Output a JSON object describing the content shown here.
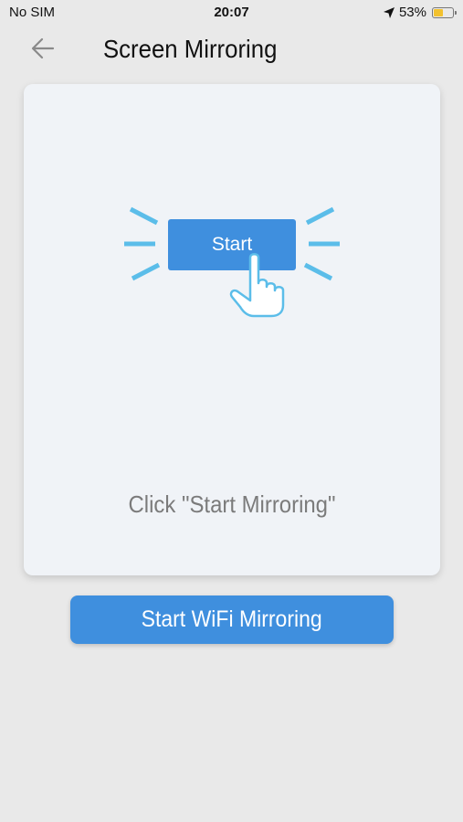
{
  "status_bar": {
    "carrier": "No SIM",
    "time": "20:07",
    "battery_percent": "53%",
    "battery_level": 0.53,
    "icons": [
      "location-arrow-icon",
      "battery-icon"
    ]
  },
  "nav": {
    "back_icon": "arrow-left-icon",
    "title": "Screen Mirroring"
  },
  "card": {
    "illustration": {
      "button_label": "Start",
      "icons": [
        "tap-hand-icon",
        "ray-lines-icon"
      ]
    },
    "hint": "Click \"Start Mirroring\""
  },
  "primary_button": {
    "label": "Start WiFi Mirroring"
  },
  "colors": {
    "accent": "#3f8fde",
    "ray": "#5bbde9",
    "background": "#e9e9e9",
    "card": "#f0f3f7",
    "battery": "#f2c12e"
  }
}
